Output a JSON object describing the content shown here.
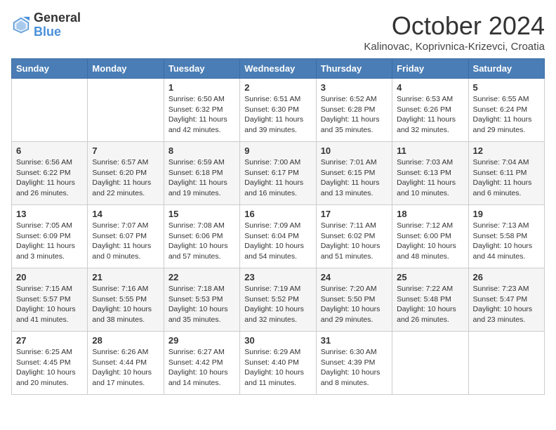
{
  "header": {
    "logo_general": "General",
    "logo_blue": "Blue",
    "month_title": "October 2024",
    "location": "Kalinovac, Koprivnica-Krizevci, Croatia"
  },
  "days_of_week": [
    "Sunday",
    "Monday",
    "Tuesday",
    "Wednesday",
    "Thursday",
    "Friday",
    "Saturday"
  ],
  "weeks": [
    [
      {
        "day": "",
        "lines": []
      },
      {
        "day": "",
        "lines": []
      },
      {
        "day": "1",
        "lines": [
          "Sunrise: 6:50 AM",
          "Sunset: 6:32 PM",
          "Daylight: 11 hours and 42 minutes."
        ]
      },
      {
        "day": "2",
        "lines": [
          "Sunrise: 6:51 AM",
          "Sunset: 6:30 PM",
          "Daylight: 11 hours and 39 minutes."
        ]
      },
      {
        "day": "3",
        "lines": [
          "Sunrise: 6:52 AM",
          "Sunset: 6:28 PM",
          "Daylight: 11 hours and 35 minutes."
        ]
      },
      {
        "day": "4",
        "lines": [
          "Sunrise: 6:53 AM",
          "Sunset: 6:26 PM",
          "Daylight: 11 hours and 32 minutes."
        ]
      },
      {
        "day": "5",
        "lines": [
          "Sunrise: 6:55 AM",
          "Sunset: 6:24 PM",
          "Daylight: 11 hours and 29 minutes."
        ]
      }
    ],
    [
      {
        "day": "6",
        "lines": [
          "Sunrise: 6:56 AM",
          "Sunset: 6:22 PM",
          "Daylight: 11 hours and 26 minutes."
        ]
      },
      {
        "day": "7",
        "lines": [
          "Sunrise: 6:57 AM",
          "Sunset: 6:20 PM",
          "Daylight: 11 hours and 22 minutes."
        ]
      },
      {
        "day": "8",
        "lines": [
          "Sunrise: 6:59 AM",
          "Sunset: 6:18 PM",
          "Daylight: 11 hours and 19 minutes."
        ]
      },
      {
        "day": "9",
        "lines": [
          "Sunrise: 7:00 AM",
          "Sunset: 6:17 PM",
          "Daylight: 11 hours and 16 minutes."
        ]
      },
      {
        "day": "10",
        "lines": [
          "Sunrise: 7:01 AM",
          "Sunset: 6:15 PM",
          "Daylight: 11 hours and 13 minutes."
        ]
      },
      {
        "day": "11",
        "lines": [
          "Sunrise: 7:03 AM",
          "Sunset: 6:13 PM",
          "Daylight: 11 hours and 10 minutes."
        ]
      },
      {
        "day": "12",
        "lines": [
          "Sunrise: 7:04 AM",
          "Sunset: 6:11 PM",
          "Daylight: 11 hours and 6 minutes."
        ]
      }
    ],
    [
      {
        "day": "13",
        "lines": [
          "Sunrise: 7:05 AM",
          "Sunset: 6:09 PM",
          "Daylight: 11 hours and 3 minutes."
        ]
      },
      {
        "day": "14",
        "lines": [
          "Sunrise: 7:07 AM",
          "Sunset: 6:07 PM",
          "Daylight: 11 hours and 0 minutes."
        ]
      },
      {
        "day": "15",
        "lines": [
          "Sunrise: 7:08 AM",
          "Sunset: 6:06 PM",
          "Daylight: 10 hours and 57 minutes."
        ]
      },
      {
        "day": "16",
        "lines": [
          "Sunrise: 7:09 AM",
          "Sunset: 6:04 PM",
          "Daylight: 10 hours and 54 minutes."
        ]
      },
      {
        "day": "17",
        "lines": [
          "Sunrise: 7:11 AM",
          "Sunset: 6:02 PM",
          "Daylight: 10 hours and 51 minutes."
        ]
      },
      {
        "day": "18",
        "lines": [
          "Sunrise: 7:12 AM",
          "Sunset: 6:00 PM",
          "Daylight: 10 hours and 48 minutes."
        ]
      },
      {
        "day": "19",
        "lines": [
          "Sunrise: 7:13 AM",
          "Sunset: 5:58 PM",
          "Daylight: 10 hours and 44 minutes."
        ]
      }
    ],
    [
      {
        "day": "20",
        "lines": [
          "Sunrise: 7:15 AM",
          "Sunset: 5:57 PM",
          "Daylight: 10 hours and 41 minutes."
        ]
      },
      {
        "day": "21",
        "lines": [
          "Sunrise: 7:16 AM",
          "Sunset: 5:55 PM",
          "Daylight: 10 hours and 38 minutes."
        ]
      },
      {
        "day": "22",
        "lines": [
          "Sunrise: 7:18 AM",
          "Sunset: 5:53 PM",
          "Daylight: 10 hours and 35 minutes."
        ]
      },
      {
        "day": "23",
        "lines": [
          "Sunrise: 7:19 AM",
          "Sunset: 5:52 PM",
          "Daylight: 10 hours and 32 minutes."
        ]
      },
      {
        "day": "24",
        "lines": [
          "Sunrise: 7:20 AM",
          "Sunset: 5:50 PM",
          "Daylight: 10 hours and 29 minutes."
        ]
      },
      {
        "day": "25",
        "lines": [
          "Sunrise: 7:22 AM",
          "Sunset: 5:48 PM",
          "Daylight: 10 hours and 26 minutes."
        ]
      },
      {
        "day": "26",
        "lines": [
          "Sunrise: 7:23 AM",
          "Sunset: 5:47 PM",
          "Daylight: 10 hours and 23 minutes."
        ]
      }
    ],
    [
      {
        "day": "27",
        "lines": [
          "Sunrise: 6:25 AM",
          "Sunset: 4:45 PM",
          "Daylight: 10 hours and 20 minutes."
        ]
      },
      {
        "day": "28",
        "lines": [
          "Sunrise: 6:26 AM",
          "Sunset: 4:44 PM",
          "Daylight: 10 hours and 17 minutes."
        ]
      },
      {
        "day": "29",
        "lines": [
          "Sunrise: 6:27 AM",
          "Sunset: 4:42 PM",
          "Daylight: 10 hours and 14 minutes."
        ]
      },
      {
        "day": "30",
        "lines": [
          "Sunrise: 6:29 AM",
          "Sunset: 4:40 PM",
          "Daylight: 10 hours and 11 minutes."
        ]
      },
      {
        "day": "31",
        "lines": [
          "Sunrise: 6:30 AM",
          "Sunset: 4:39 PM",
          "Daylight: 10 hours and 8 minutes."
        ]
      },
      {
        "day": "",
        "lines": []
      },
      {
        "day": "",
        "lines": []
      }
    ]
  ]
}
